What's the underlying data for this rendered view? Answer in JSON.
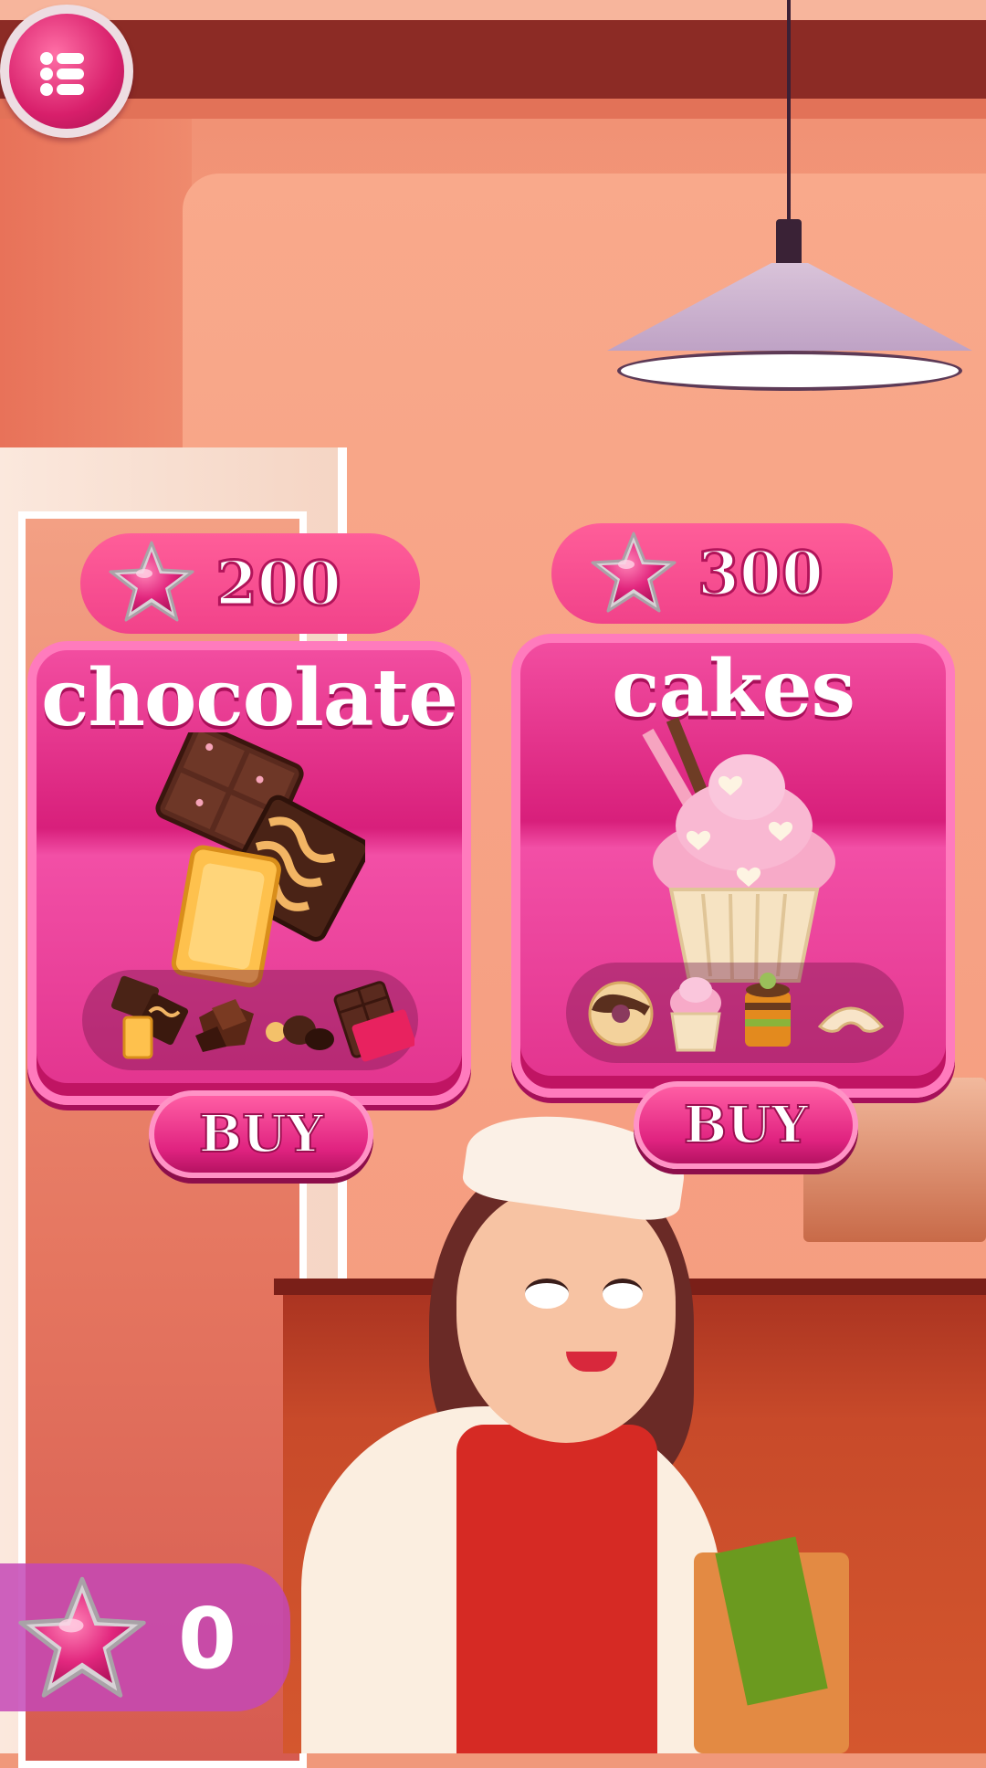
{
  "header": {
    "menu_icon": "menu-dots-icon"
  },
  "shop": {
    "items": [
      {
        "title": "chocolate",
        "price": "200",
        "currency_icon": "star-icon",
        "buy_label": "BUY",
        "hero_image": "chocolate-bars-illustration",
        "preview_icons": [
          "chocolate-bars-icon",
          "chocolate-chunks-icon",
          "truffles-icon",
          "chocolate-bar-wrapped-icon"
        ]
      },
      {
        "title": "cakes",
        "price": "300",
        "currency_icon": "star-icon",
        "buy_label": "BUY",
        "hero_image": "cupcake-illustration",
        "preview_icons": [
          "donut-icon",
          "cupcake-icon",
          "layer-cake-icon",
          "croissant-icon"
        ]
      }
    ]
  },
  "wallet": {
    "balance": "0",
    "currency_icon": "star-icon"
  },
  "colors": {
    "accent": "#e0247f",
    "pill": "#f4478d",
    "balance_bg": "#c448b6",
    "text": "#ffffff"
  }
}
